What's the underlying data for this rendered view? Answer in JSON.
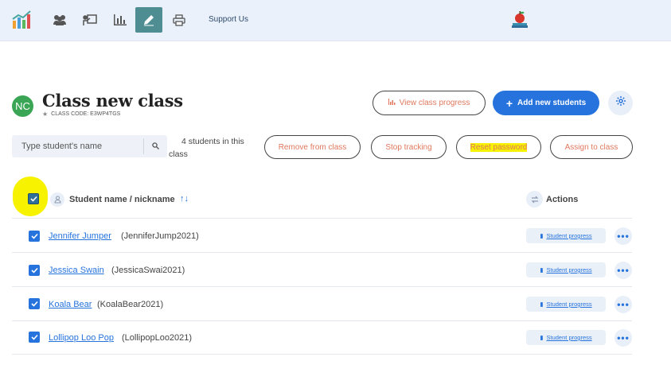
{
  "nav": {
    "support_label": "Support Us",
    "icons": [
      "logo-chart-icon",
      "students-icon",
      "teacher-board-icon",
      "reports-chart-icon",
      "pencil-icon",
      "print-icon"
    ]
  },
  "class": {
    "avatar_initials": "NC",
    "title": "Class new class",
    "code_label": "CLASS CODE: E3WP4TGS"
  },
  "actions": {
    "view_progress": "View class progress",
    "add_students": "Add new students",
    "remove": "Remove from class",
    "stop_tracking": "Stop tracking",
    "reset_password": "Reset password",
    "assign": "Assign to class"
  },
  "search": {
    "placeholder": "Type student's name"
  },
  "student_count": "4 students in this class",
  "table": {
    "header_name": "Student name / nickname",
    "header_actions": "Actions",
    "progress_label": "Student progress",
    "rows": [
      {
        "name": "Jennifer Jumper",
        "nick": "(JenniferJump2021)",
        "checked": true
      },
      {
        "name": "Jessica Swain",
        "nick": "(JessicaSwai2021)",
        "checked": true
      },
      {
        "name": "Koala Bear",
        "nick": "(KoalaBear2021)",
        "checked": true
      },
      {
        "name": "Lollipop Loo Pop",
        "nick": "(LollipopLoo2021)",
        "checked": true
      }
    ]
  },
  "colors": {
    "accent": "#2673dd",
    "outline_text": "#e0785e",
    "avatar": "#3aa655",
    "highlight": "#f6f200",
    "topbar": "#eaf1fb"
  }
}
